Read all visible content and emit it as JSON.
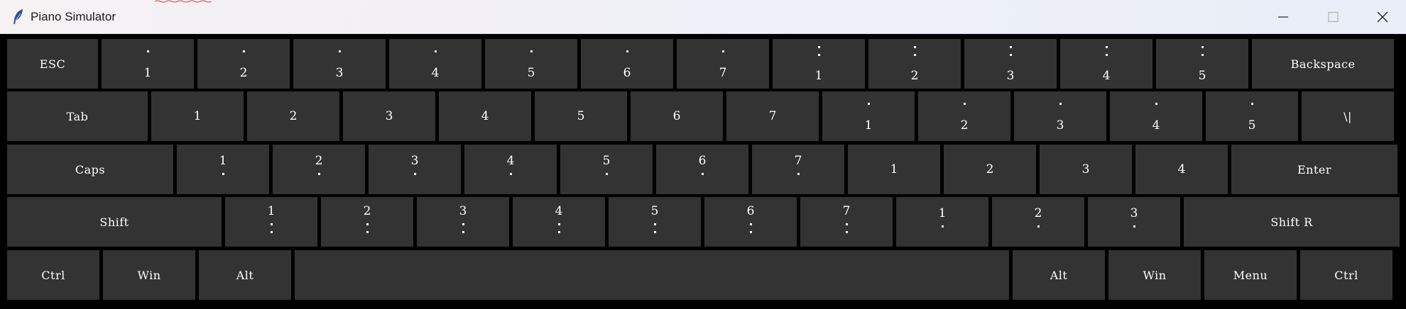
{
  "window": {
    "title": "Piano Simulator",
    "icon": "feather-icon",
    "controls": [
      "minimize-icon",
      "maximize-icon",
      "close-icon"
    ]
  },
  "colors": {
    "key_background": "#333333",
    "key_text": "#ffffff",
    "keyboard_background": "#000000"
  },
  "keyboard": {
    "rows": [
      [
        {
          "kind": "label",
          "text": "ESC",
          "width": 128
        },
        {
          "kind": "note",
          "note": "1",
          "octave": "high"
        },
        {
          "kind": "note",
          "note": "2",
          "octave": "high"
        },
        {
          "kind": "note",
          "note": "3",
          "octave": "high"
        },
        {
          "kind": "note",
          "note": "4",
          "octave": "high"
        },
        {
          "kind": "note",
          "note": "5",
          "octave": "high"
        },
        {
          "kind": "note",
          "note": "6",
          "octave": "high"
        },
        {
          "kind": "note",
          "note": "7",
          "octave": "high"
        },
        {
          "kind": "note",
          "note": "1",
          "octave": "high2"
        },
        {
          "kind": "note",
          "note": "2",
          "octave": "high2"
        },
        {
          "kind": "note",
          "note": "3",
          "octave": "high2"
        },
        {
          "kind": "note",
          "note": "4",
          "octave": "high2"
        },
        {
          "kind": "note",
          "note": "5",
          "octave": "high2"
        },
        {
          "kind": "label",
          "text": "Backspace",
          "width": 200
        }
      ],
      [
        {
          "kind": "label",
          "text": "Tab",
          "width": 198
        },
        {
          "kind": "note",
          "note": "1",
          "octave": "mid"
        },
        {
          "kind": "note",
          "note": "2",
          "octave": "mid"
        },
        {
          "kind": "note",
          "note": "3",
          "octave": "mid"
        },
        {
          "kind": "note",
          "note": "4",
          "octave": "mid"
        },
        {
          "kind": "note",
          "note": "5",
          "octave": "mid"
        },
        {
          "kind": "note",
          "note": "6",
          "octave": "mid"
        },
        {
          "kind": "note",
          "note": "7",
          "octave": "mid"
        },
        {
          "kind": "note",
          "note": "1",
          "octave": "high"
        },
        {
          "kind": "note",
          "note": "2",
          "octave": "high"
        },
        {
          "kind": "note",
          "note": "3",
          "octave": "high"
        },
        {
          "kind": "note",
          "note": "4",
          "octave": "high"
        },
        {
          "kind": "note",
          "note": "5",
          "octave": "high"
        },
        {
          "kind": "label",
          "text": "\\|",
          "width": 130
        }
      ],
      [
        {
          "kind": "label",
          "text": "Caps",
          "width": 234
        },
        {
          "kind": "note",
          "note": "1",
          "octave": "low"
        },
        {
          "kind": "note",
          "note": "2",
          "octave": "low"
        },
        {
          "kind": "note",
          "note": "3",
          "octave": "low"
        },
        {
          "kind": "note",
          "note": "4",
          "octave": "low"
        },
        {
          "kind": "note",
          "note": "5",
          "octave": "low"
        },
        {
          "kind": "note",
          "note": "6",
          "octave": "low"
        },
        {
          "kind": "note",
          "note": "7",
          "octave": "low"
        },
        {
          "kind": "note",
          "note": "1",
          "octave": "mid"
        },
        {
          "kind": "note",
          "note": "2",
          "octave": "mid"
        },
        {
          "kind": "note",
          "note": "3",
          "octave": "mid"
        },
        {
          "kind": "note",
          "note": "4",
          "octave": "mid"
        },
        {
          "kind": "label",
          "text": "Enter",
          "width": 234
        }
      ],
      [
        {
          "kind": "label",
          "text": "Shift",
          "width": 302
        },
        {
          "kind": "note",
          "note": "1",
          "octave": "low2"
        },
        {
          "kind": "note",
          "note": "2",
          "octave": "low2"
        },
        {
          "kind": "note",
          "note": "3",
          "octave": "low2"
        },
        {
          "kind": "note",
          "note": "4",
          "octave": "low2"
        },
        {
          "kind": "note",
          "note": "5",
          "octave": "low2"
        },
        {
          "kind": "note",
          "note": "6",
          "octave": "low2"
        },
        {
          "kind": "note",
          "note": "7",
          "octave": "low2"
        },
        {
          "kind": "note",
          "note": "1",
          "octave": "low"
        },
        {
          "kind": "note",
          "note": "2",
          "octave": "low"
        },
        {
          "kind": "note",
          "note": "3",
          "octave": "low"
        },
        {
          "kind": "label",
          "text": "Shift R",
          "width": 304
        }
      ],
      [
        {
          "kind": "label",
          "text": "Ctrl",
          "width": 130
        },
        {
          "kind": "label",
          "text": "Win",
          "width": 130
        },
        {
          "kind": "label",
          "text": "Alt",
          "width": 130
        },
        {
          "kind": "label",
          "text": "",
          "width": 1006,
          "name": "spacebar"
        },
        {
          "kind": "label",
          "text": "Alt",
          "width": 130
        },
        {
          "kind": "label",
          "text": "Win",
          "width": 130
        },
        {
          "kind": "label",
          "text": "Menu",
          "width": 130
        },
        {
          "kind": "label",
          "text": "Ctrl",
          "width": 130
        }
      ]
    ]
  }
}
